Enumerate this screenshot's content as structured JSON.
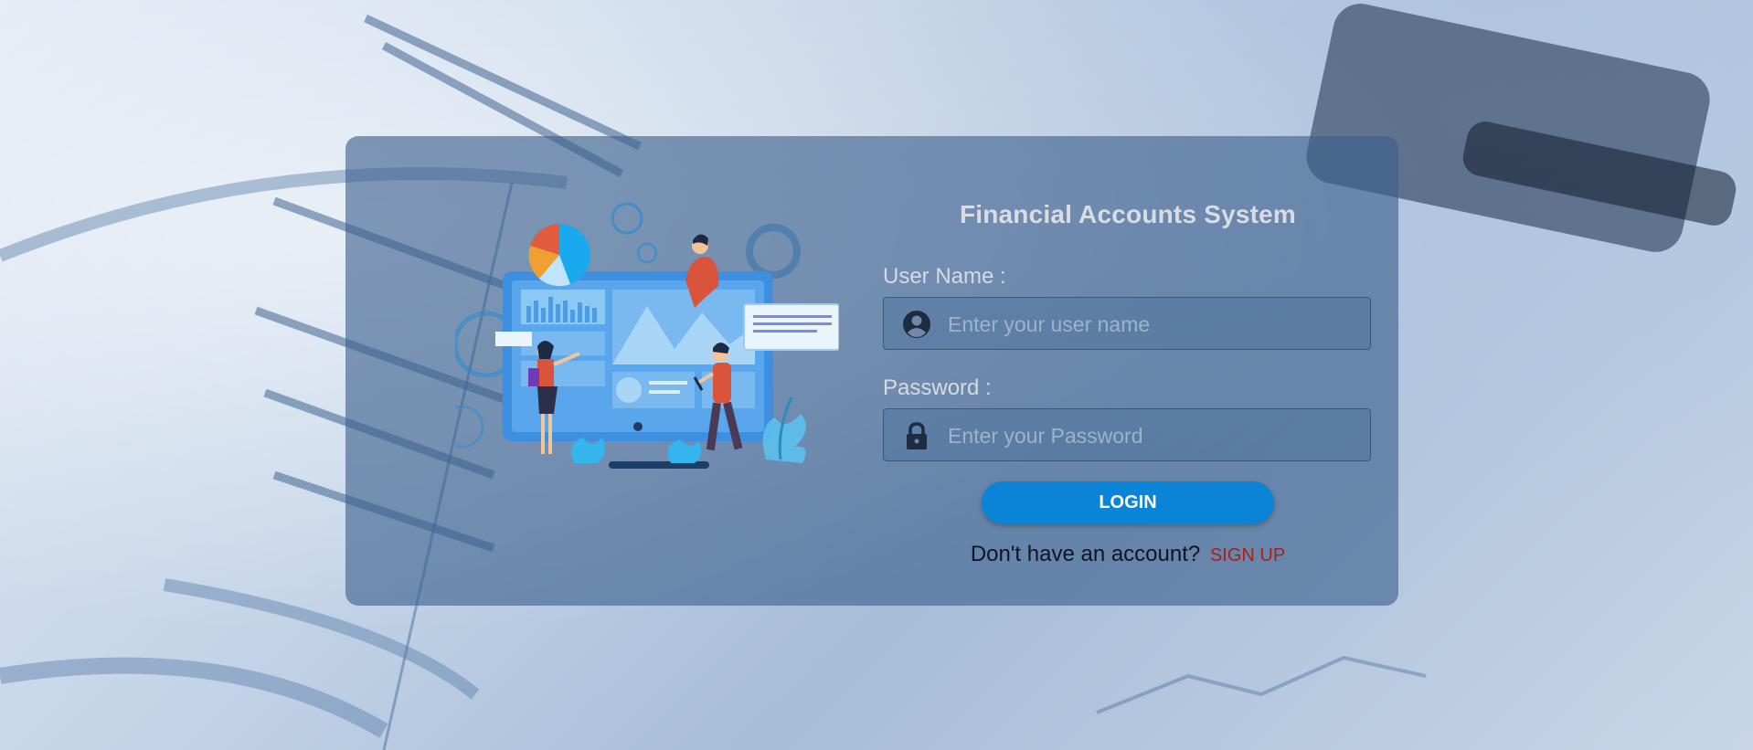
{
  "app": {
    "title": "Financial Accounts System"
  },
  "form": {
    "username": {
      "label": "User Name :",
      "placeholder": "Enter your user name",
      "value": "",
      "icon": "user-circle-icon"
    },
    "password": {
      "label": "Password :",
      "placeholder": "Enter your Password",
      "value": "",
      "icon": "lock-icon"
    },
    "login_label": "LOGIN",
    "signup_prompt": "Don't have an account?",
    "signup_label": "SIGN UP"
  },
  "illustration": {
    "name": "finance-dashboard-illustration"
  },
  "colors": {
    "accent": "#0a84d6",
    "signup_link": "#a8201a",
    "card": "#3c5f8c"
  }
}
